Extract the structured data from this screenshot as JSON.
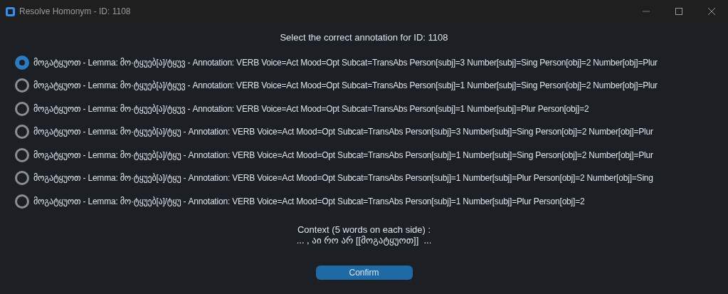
{
  "window": {
    "title": "Resolve Homonym - ID: 1108"
  },
  "heading": "Select the correct annotation for ID: 1108",
  "options": [
    {
      "label": "მოგატყუოთ - Lemma: მო·ტყუებ[ა]/ტყუვ - Annotation: VERB Voice=Act Mood=Opt Subcat=TransAbs Person[subj]=3 Number[subj]=Sing Person[obj]=2 Number[obj]=Plur",
      "selected": true
    },
    {
      "label": "მოგატყუოთ - Lemma: მო·ტყუებ[ა]/ტყუვ - Annotation: VERB Voice=Act Mood=Opt Subcat=TransAbs Person[subj]=1 Number[subj]=Sing Person[obj]=2 Number[obj]=Plur",
      "selected": false
    },
    {
      "label": "მოგატყუოთ - Lemma: მო·ტყუებ[ა]/ტყუვ - Annotation: VERB Voice=Act Mood=Opt Subcat=TransAbs Person[subj]=1 Number[subj]=Plur Person[obj]=2",
      "selected": false
    },
    {
      "label": "მოგატყუოთ - Lemma: მო·ტყუებ[ა]/ტყუ - Annotation: VERB Voice=Act Mood=Opt Subcat=TransAbs Person[subj]=3 Number[subj]=Sing Person[obj]=2 Number[obj]=Plur",
      "selected": false
    },
    {
      "label": "მოგატყუოთ - Lemma: მო·ტყუებ[ა]/ტყუ - Annotation: VERB Voice=Act Mood=Opt Subcat=TransAbs Person[subj]=1 Number[subj]=Sing Person[obj]=2 Number[obj]=Plur",
      "selected": false
    },
    {
      "label": "მოგატყუოთ - Lemma: მო·ტყუებ[ა]/ტყუ - Annotation: VERB Voice=Act Mood=Opt Subcat=TransAbs Person[subj]=1 Number[subj]=Plur Person[obj]=2 Number[obj]=Sing",
      "selected": false
    },
    {
      "label": "მოგატყუოთ - Lemma: მო·ტყუებ[ა]/ტყუ - Annotation: VERB Voice=Act Mood=Opt Subcat=TransAbs Person[subj]=1 Number[subj]=Plur Person[obj]=2",
      "selected": false
    }
  ],
  "context": {
    "title": "Context (5 words on each side) :",
    "text": "... , აი რო არ [[მოგატყუოთ]]  ..."
  },
  "confirm_button": "Confirm"
}
